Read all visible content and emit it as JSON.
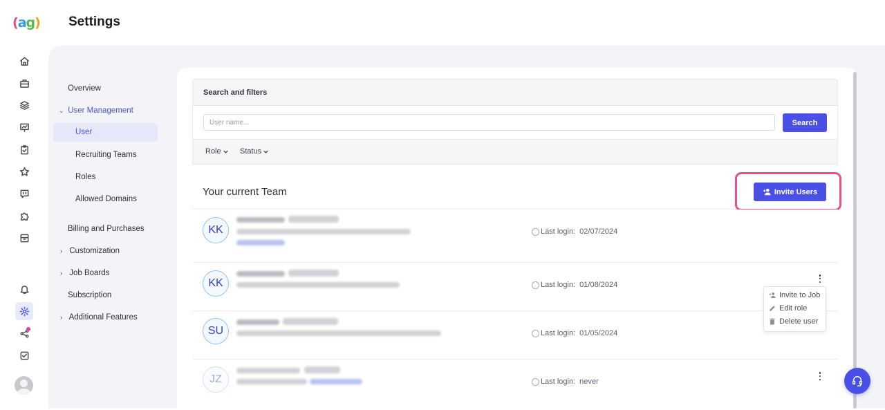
{
  "app": {
    "page_title": "Settings"
  },
  "logo": {
    "open": "(",
    "a": "a",
    "g": "g",
    "close": ")"
  },
  "rail": {
    "icons": [
      "home-icon",
      "briefcase-icon",
      "layers-icon",
      "presentation-icon",
      "clipboard-check-icon",
      "star-icon",
      "chat-icon",
      "puzzle-icon",
      "archive-icon",
      "bell-icon",
      "gear-icon",
      "share-icon",
      "checkbox-icon"
    ],
    "active": "gear-icon"
  },
  "subnav": {
    "overview": "Overview",
    "user_management": "User Management",
    "user": "User",
    "recruiting_teams": "Recruiting Teams",
    "roles": "Roles",
    "allowed_domains": "Allowed Domains",
    "billing": "Billing and Purchases",
    "customization": "Customization",
    "job_boards": "Job Boards",
    "subscription": "Subscription",
    "additional_features": "Additional Features"
  },
  "filters": {
    "title": "Search and filters",
    "search_placeholder": "User name...",
    "search_button": "Search",
    "role": "Role",
    "status": "Status"
  },
  "team": {
    "title": "Your current Team",
    "invite_button": "Invite Users",
    "last_login_label": "Last login:",
    "rows": [
      {
        "initials": "KK",
        "last_login": "02/07/2024"
      },
      {
        "initials": "KK",
        "last_login": "01/08/2024"
      },
      {
        "initials": "SU",
        "last_login": "01/05/2024"
      },
      {
        "initials": "JZ",
        "last_login": "never"
      }
    ]
  },
  "row_menu": {
    "invite_to_job": "Invite to Job",
    "edit_role": "Edit role",
    "delete_user": "Delete user"
  },
  "colors": {
    "accent": "#4a50e6",
    "highlight": "#ea4f86"
  }
}
